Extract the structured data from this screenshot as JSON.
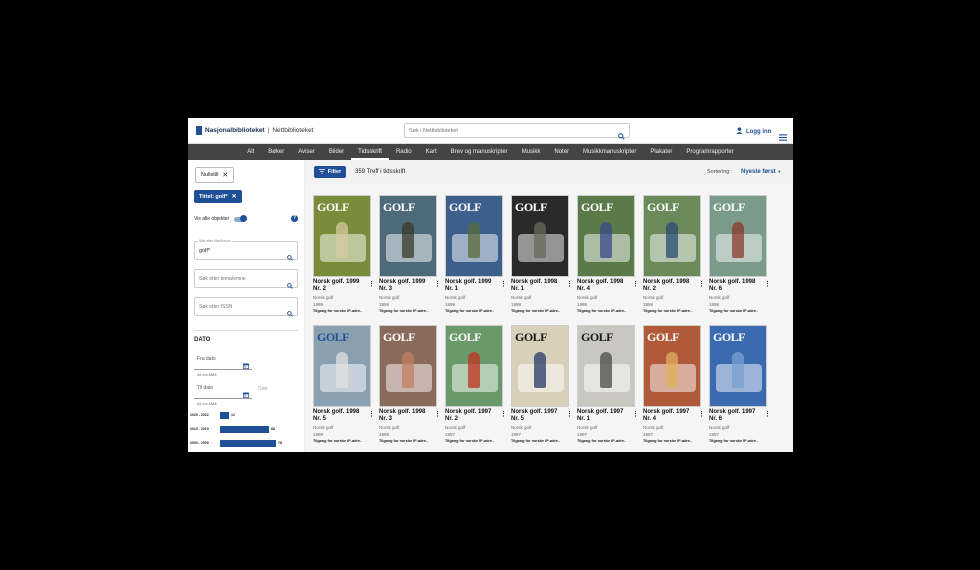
{
  "header": {
    "logo_main": "Nasjonalbiblioteket",
    "logo_sep": "|",
    "logo_sub": "Nettbiblioteket",
    "search_placeholder": "Søk i Nettbiblioteket",
    "login_label": "Logg inn"
  },
  "nav": {
    "items": [
      "Alt",
      "Bøker",
      "Aviser",
      "Bilder",
      "Tidsskrift",
      "Radio",
      "Kart",
      "Brev og manuskripter",
      "Musikk",
      "Noter",
      "Musikkmanuskripter",
      "Plakater",
      "Programrapporter"
    ],
    "active": "Tidsskrift"
  },
  "sidebar": {
    "reset_label": "Nullstill",
    "title_filter": "Tittel: golf*",
    "show_all_label": "Vis alle objekter",
    "title_search_label": "Søk etter tittel/forum",
    "title_search_value": "golf*",
    "topic_placeholder": "Søk etter tema/emne",
    "issn_placeholder": "Søk etter ISSN",
    "date_heading": "DATO",
    "from_placeholder": "Fra dato",
    "to_placeholder": "Til dato",
    "date_hint": "dd.mm.åååå",
    "search_label": "Søk",
    "histogram": [
      {
        "label": "2020 - 2022",
        "count": 12
      },
      {
        "label": "2010 - 2019",
        "count": 68
      },
      {
        "label": "2000 - 2009",
        "count": 78
      }
    ]
  },
  "toolbar": {
    "filter_label": "Filter",
    "hits_text": "359 Treff i tidsskrift",
    "sort_label": "Sortering :",
    "sort_value": "Nyeste først"
  },
  "results": [
    {
      "title": "Norsk golf. 1999 Nr. 2",
      "sub": "Norsk golf",
      "year": "1999",
      "access": "Tilgang for norske IP-adre..",
      "bg": "#7a8c3a",
      "mast_color": "#ffffff",
      "fig": "#d6c9a0"
    },
    {
      "title": "Norsk golf. 1999 Nr. 3",
      "sub": "Norsk golf",
      "year": "1999",
      "access": "Tilgang for norske IP-adre..",
      "bg": "#4d6a7a",
      "mast_color": "#ffffff",
      "fig": "#3a3a2a"
    },
    {
      "title": "Norsk golf. 1999 Nr. 1",
      "sub": "Norsk golf",
      "year": "1999",
      "access": "Tilgang for norske IP-adre..",
      "bg": "#3d5f8c",
      "mast_color": "#ffffff",
      "fig": "#5a6b3a"
    },
    {
      "title": "Norsk golf. 1998 Nr. 1",
      "sub": "Norsk golf",
      "year": "1998",
      "access": "Tilgang for norske IP-adre..",
      "bg": "#2a2a2a",
      "mast_color": "#ffffff",
      "fig": "#6b6b55"
    },
    {
      "title": "Norsk golf. 1998 Nr. 4",
      "sub": "Norsk golf",
      "year": "1998",
      "access": "Tilgang for norske IP-adre..",
      "bg": "#5a7a4a",
      "mast_color": "#ffffff",
      "fig": "#3a4a8a"
    },
    {
      "title": "Norsk golf. 1998 Nr. 2",
      "sub": "Norsk golf",
      "year": "1998",
      "access": "Tilgang for norske IP-adre..",
      "bg": "#6a8a5a",
      "mast_color": "#ffffff",
      "fig": "#2a4a7a"
    },
    {
      "title": "Norsk golf. 1998 Nr. 6",
      "sub": "Norsk golf",
      "year": "1998",
      "access": "Tilgang for norske IP-adre..",
      "bg": "#7a9a8a",
      "mast_color": "#ffffff",
      "fig": "#8a3a2a"
    },
    {
      "title": "Norsk golf. 1998 Nr. 5",
      "sub": "Norsk golf",
      "year": "1998",
      "access": "Tilgang for norske IP-adre..",
      "bg": "#8aa0b0",
      "mast_color": "#1f4f96",
      "fig": "#e0e0e0"
    },
    {
      "title": "Norsk golf. 1998 Nr. 3",
      "sub": "Norsk golf",
      "year": "1998",
      "access": "Tilgang for norske IP-adre..",
      "bg": "#8a6a5a",
      "mast_color": "#ffffff",
      "fig": "#c08060"
    },
    {
      "title": "Norsk golf. 1997 Nr. 2",
      "sub": "Norsk golf",
      "year": "1997",
      "access": "Tilgang for norske IP-adre..",
      "bg": "#6a9a6a",
      "mast_color": "#ffffff",
      "fig": "#c03020"
    },
    {
      "title": "Norsk golf. 1997 Nr. 5",
      "sub": "Norsk golf",
      "year": "1997",
      "access": "Tilgang for norske IP-adre..",
      "bg": "#d8d0b8",
      "mast_color": "#1a1a1a",
      "fig": "#2a3a6a"
    },
    {
      "title": "Norsk golf. 1997 Nr. 1",
      "sub": "Norsk golf",
      "year": "1997",
      "access": "Tilgang for norske IP-adre..",
      "bg": "#c8c8c0",
      "mast_color": "#1a1a1a",
      "fig": "#4a4a4a"
    },
    {
      "title": "Norsk golf. 1997 Nr. 4",
      "sub": "Norsk golf",
      "year": "1997",
      "access": "Tilgang for norske IP-adre..",
      "bg": "#b05a3a",
      "mast_color": "#ffffff",
      "fig": "#e0b060"
    },
    {
      "title": "Norsk golf. 1997 Nr. 6",
      "sub": "Norsk golf",
      "year": "1997",
      "access": "Tilgang for norske IP-adre..",
      "bg": "#3a6ab0",
      "mast_color": "#ffffff",
      "fig": "#7aa0d0"
    }
  ],
  "cover_masthead": "GOLF",
  "colors": {
    "accent": "#1f4f96",
    "nav_bg": "#444444"
  }
}
